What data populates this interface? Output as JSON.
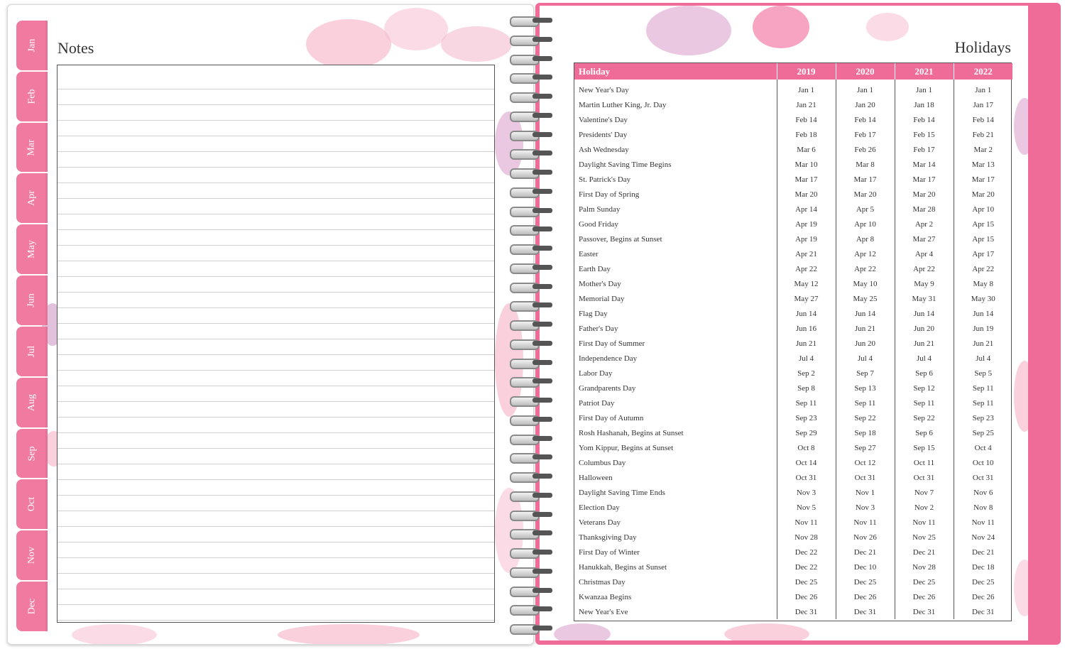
{
  "left_page": {
    "tabs": [
      "Jan",
      "Feb",
      "Mar",
      "Apr",
      "May",
      "Jun",
      "Jul",
      "Aug",
      "Sep",
      "Oct",
      "Nov",
      "Dec"
    ],
    "notes_title": "Notes"
  },
  "right_page": {
    "holidays_title": "Holidays",
    "table": {
      "headers": [
        "Holiday",
        "2019",
        "2020",
        "2021",
        "2022"
      ],
      "rows": [
        [
          "New Year's Day",
          "Jan 1",
          "Jan 1",
          "Jan 1",
          "Jan 1"
        ],
        [
          "Martin Luther King, Jr. Day",
          "Jan 21",
          "Jan 20",
          "Jan 18",
          "Jan 17"
        ],
        [
          "Valentine's Day",
          "Feb 14",
          "Feb 14",
          "Feb 14",
          "Feb 14"
        ],
        [
          "Presidents' Day",
          "Feb 18",
          "Feb 17",
          "Feb 15",
          "Feb 21"
        ],
        [
          "Ash Wednesday",
          "Mar 6",
          "Feb 26",
          "Feb 17",
          "Mar 2"
        ],
        [
          "Daylight Saving Time Begins",
          "Mar 10",
          "Mar 8",
          "Mar 14",
          "Mar 13"
        ],
        [
          "St. Patrick's Day",
          "Mar 17",
          "Mar 17",
          "Mar 17",
          "Mar 17"
        ],
        [
          "First Day of Spring",
          "Mar 20",
          "Mar 20",
          "Mar 20",
          "Mar 20"
        ],
        [
          "Palm Sunday",
          "Apr 14",
          "Apr 5",
          "Mar 28",
          "Apr 10"
        ],
        [
          "Good Friday",
          "Apr 19",
          "Apr 10",
          "Apr 2",
          "Apr 15"
        ],
        [
          "Passover, Begins at Sunset",
          "Apr 19",
          "Apr 8",
          "Mar 27",
          "Apr 15"
        ],
        [
          "Easter",
          "Apr 21",
          "Apr 12",
          "Apr 4",
          "Apr 17"
        ],
        [
          "Earth Day",
          "Apr 22",
          "Apr 22",
          "Apr 22",
          "Apr 22"
        ],
        [
          "Mother's Day",
          "May 12",
          "May 10",
          "May 9",
          "May 8"
        ],
        [
          "Memorial Day",
          "May 27",
          "May 25",
          "May 31",
          "May 30"
        ],
        [
          "Flag Day",
          "Jun 14",
          "Jun 14",
          "Jun 14",
          "Jun 14"
        ],
        [
          "Father's Day",
          "Jun 16",
          "Jun 21",
          "Jun 20",
          "Jun 19"
        ],
        [
          "First Day of Summer",
          "Jun 21",
          "Jun 20",
          "Jun 21",
          "Jun 21"
        ],
        [
          "Independence Day",
          "Jul 4",
          "Jul 4",
          "Jul 4",
          "Jul 4"
        ],
        [
          "Labor Day",
          "Sep 2",
          "Sep 7",
          "Sep 6",
          "Sep 5"
        ],
        [
          "Grandparents Day",
          "Sep 8",
          "Sep 13",
          "Sep 12",
          "Sep 11"
        ],
        [
          "Patriot Day",
          "Sep 11",
          "Sep 11",
          "Sep 11",
          "Sep 11"
        ],
        [
          "First Day of Autumn",
          "Sep 23",
          "Sep 22",
          "Sep 22",
          "Sep 23"
        ],
        [
          "Rosh Hashanah, Begins at Sunset",
          "Sep 29",
          "Sep 18",
          "Sep 6",
          "Sep 25"
        ],
        [
          "Yom Kippur, Begins at Sunset",
          "Oct 8",
          "Sep 27",
          "Sep 15",
          "Oct 4"
        ],
        [
          "Columbus Day",
          "Oct 14",
          "Oct 12",
          "Oct 11",
          "Oct 10"
        ],
        [
          "Halloween",
          "Oct 31",
          "Oct 31",
          "Oct 31",
          "Oct 31"
        ],
        [
          "Daylight Saving Time Ends",
          "Nov 3",
          "Nov 1",
          "Nov 7",
          "Nov 6"
        ],
        [
          "Election Day",
          "Nov 5",
          "Nov 3",
          "Nov 2",
          "Nov 8"
        ],
        [
          "Veterans Day",
          "Nov 11",
          "Nov 11",
          "Nov 11",
          "Nov 11"
        ],
        [
          "Thanksgiving Day",
          "Nov 28",
          "Nov 26",
          "Nov 25",
          "Nov 24"
        ],
        [
          "First Day of Winter",
          "Dec 22",
          "Dec 21",
          "Dec 21",
          "Dec 21"
        ],
        [
          "Hanukkah, Begins at Sunset",
          "Dec 22",
          "Dec 10",
          "Nov 28",
          "Dec 18"
        ],
        [
          "Christmas Day",
          "Dec 25",
          "Dec 25",
          "Dec 25",
          "Dec 25"
        ],
        [
          "Kwanzaa Begins",
          "Dec 26",
          "Dec 26",
          "Dec 26",
          "Dec 26"
        ],
        [
          "New Year's Eve",
          "Dec 31",
          "Dec 31",
          "Dec 31",
          "Dec 31"
        ]
      ]
    }
  },
  "colors": {
    "accent_pink": "#ef6c98",
    "tab_pink": "#f07aa0"
  }
}
